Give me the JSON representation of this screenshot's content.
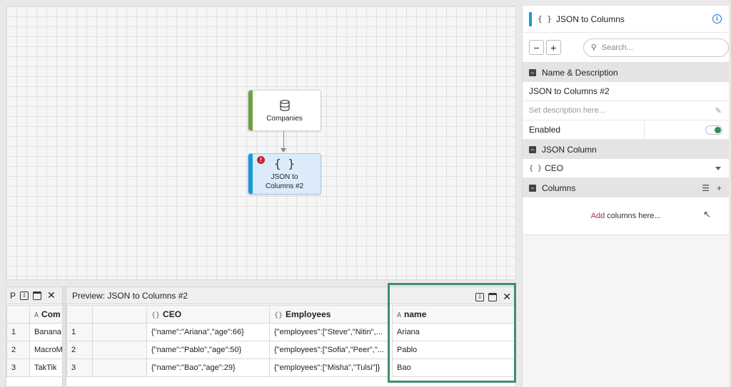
{
  "canvas": {
    "nodes": [
      {
        "label": "Companies",
        "icon": "database-icon"
      },
      {
        "label": "JSON to Columns #2",
        "icon": "braces-icon",
        "error_badge": "!"
      }
    ]
  },
  "panel": {
    "title": "JSON to Columns",
    "title_icon": "{ }",
    "search_placeholder": "Search...",
    "minus_label": "−",
    "plus_label": "+",
    "section_name": "Name & Description",
    "name_value": "JSON to Columns #2",
    "description_placeholder": "Set description here...",
    "enabled_label": "Enabled",
    "enabled": true,
    "section_json_column": "JSON Column",
    "json_column_value": "CEO",
    "section_columns": "Columns",
    "add_link": "Add",
    "add_rest": "columns here..."
  },
  "left_preview": {
    "title": "P",
    "header": "Com",
    "rows": [
      {
        "num": "1",
        "value": "Banana"
      },
      {
        "num": "2",
        "value": "MacroM"
      },
      {
        "num": "3",
        "value": "TakTik"
      }
    ]
  },
  "main_preview": {
    "title": "Preview: JSON to Columns #2",
    "headers": {
      "ceo": "CEO",
      "employees": "Employees",
      "name": "name"
    },
    "rows": [
      {
        "num": "1",
        "ceo": "{\"name\":\"Ariana\",\"age\":66}",
        "employees": "{\"employees\":[\"Steve\",\"Nitin\",...",
        "name": "Ariana"
      },
      {
        "num": "2",
        "ceo": "{\"name\":\"Pablo\",\"age\":50}",
        "employees": "{\"employees\":[\"Sofia\",\"Peer\",\"...",
        "name": "Pablo"
      },
      {
        "num": "3",
        "ceo": "{\"name\":\"Bao\",\"age\":29}",
        "employees": "{\"employees\":[\"Misha\",\"Tulsi\"]}",
        "name": "Bao"
      }
    ]
  },
  "colors": {
    "accent": "#1a9ad6",
    "source_node": "#6fa043",
    "highlight": "#3f8f6a",
    "toggle_on": "#2f8f5c"
  }
}
